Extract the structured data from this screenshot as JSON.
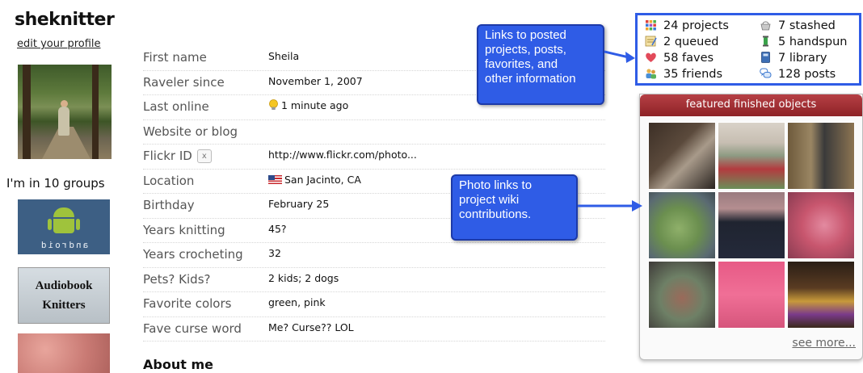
{
  "profile": {
    "username": "sheknitter",
    "edit_link": "edit your profile",
    "groups_label": "I'm in 10 groups",
    "groups": [
      "android",
      "Audiobook",
      "Knitters"
    ],
    "fields": [
      {
        "label": "First name",
        "value": "Sheila"
      },
      {
        "label": "Raveler since",
        "value": "November 1, 2007"
      },
      {
        "label": "Last online",
        "value": "1 minute ago",
        "icon": "lightbulb-icon"
      },
      {
        "label": "Website or blog",
        "value": ""
      },
      {
        "label": "Flickr ID",
        "value": "http://www.flickr.com/photo...",
        "badge": "x"
      },
      {
        "label": "Location",
        "value": "San Jacinto, CA",
        "icon": "us-flag-icon"
      },
      {
        "label": "Birthday",
        "value": "February 25"
      },
      {
        "label": "Years knitting",
        "value": "45?"
      },
      {
        "label": "Years crocheting",
        "value": "32"
      },
      {
        "label": "Pets? Kids?",
        "value": "2 kids; 2 dogs"
      },
      {
        "label": "Favorite colors",
        "value": "green, pink"
      },
      {
        "label": "Fave curse word",
        "value": "Me? Curse?? LOL"
      }
    ],
    "about_heading": "About me"
  },
  "stats": [
    {
      "text": "24 projects",
      "icon": "projects-grid-icon"
    },
    {
      "text": "2 queued",
      "icon": "queue-notepad-icon"
    },
    {
      "text": "58 faves",
      "icon": "heart-icon"
    },
    {
      "text": "35 friends",
      "icon": "friends-icon"
    },
    {
      "text": "7 stashed",
      "icon": "stash-basket-icon"
    },
    {
      "text": "5 handspun",
      "icon": "spindle-icon"
    },
    {
      "text": "7 library",
      "icon": "book-icon"
    },
    {
      "text": "128 posts",
      "icon": "speech-bubbles-icon"
    }
  ],
  "featured": {
    "header": "featured finished objects",
    "see_more": "see more..."
  },
  "callouts": {
    "top": [
      "Links to posted",
      "projects, posts,",
      "favorites, and",
      "other information"
    ],
    "middle": [
      "Photo links to",
      "project wiki",
      "contributions."
    ]
  },
  "colors": {
    "callout_blue": "#2f5ce6",
    "featured_header": "#a3353a",
    "label_gray": "#555555"
  }
}
